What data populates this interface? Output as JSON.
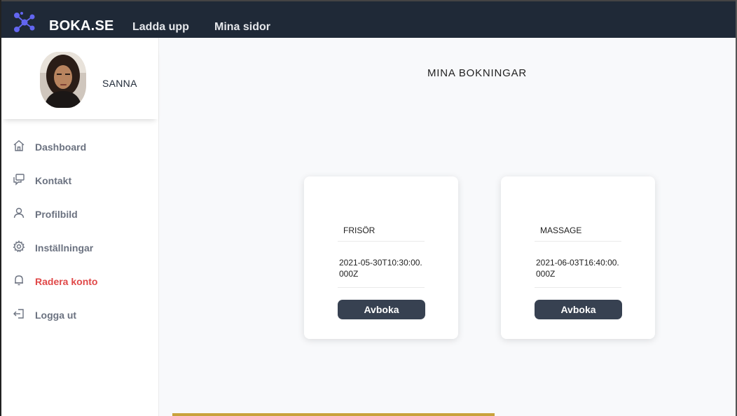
{
  "header": {
    "brand": "BOKA.SE",
    "nav": [
      "Ladda upp",
      "Mina sidor"
    ],
    "logo_icon": "molecule-logo-icon",
    "background": "#1f2937",
    "logo_color": "#6366f1"
  },
  "profile": {
    "name": "SANNA"
  },
  "sidebar": {
    "items": [
      {
        "label": "Dashboard",
        "icon": "home-icon"
      },
      {
        "label": "Kontakt",
        "icon": "chat-icon"
      },
      {
        "label": "Profilbild",
        "icon": "user-icon"
      },
      {
        "label": "Inställningar",
        "icon": "gear-icon"
      },
      {
        "label": "Radera konto",
        "icon": "bell-icon",
        "color": "#e04848"
      },
      {
        "label": "Logga ut",
        "icon": "logout-icon"
      }
    ]
  },
  "main": {
    "title": "MINA BOKNINGAR",
    "bookings": [
      {
        "service": "FRISÖR",
        "datetime": "2021-05-30T10:30:00.000Z",
        "action": "Avboka"
      },
      {
        "service": "MASSAGE",
        "datetime": "2021-06-03T16:40:00.000Z",
        "action": "Avboka"
      }
    ]
  }
}
